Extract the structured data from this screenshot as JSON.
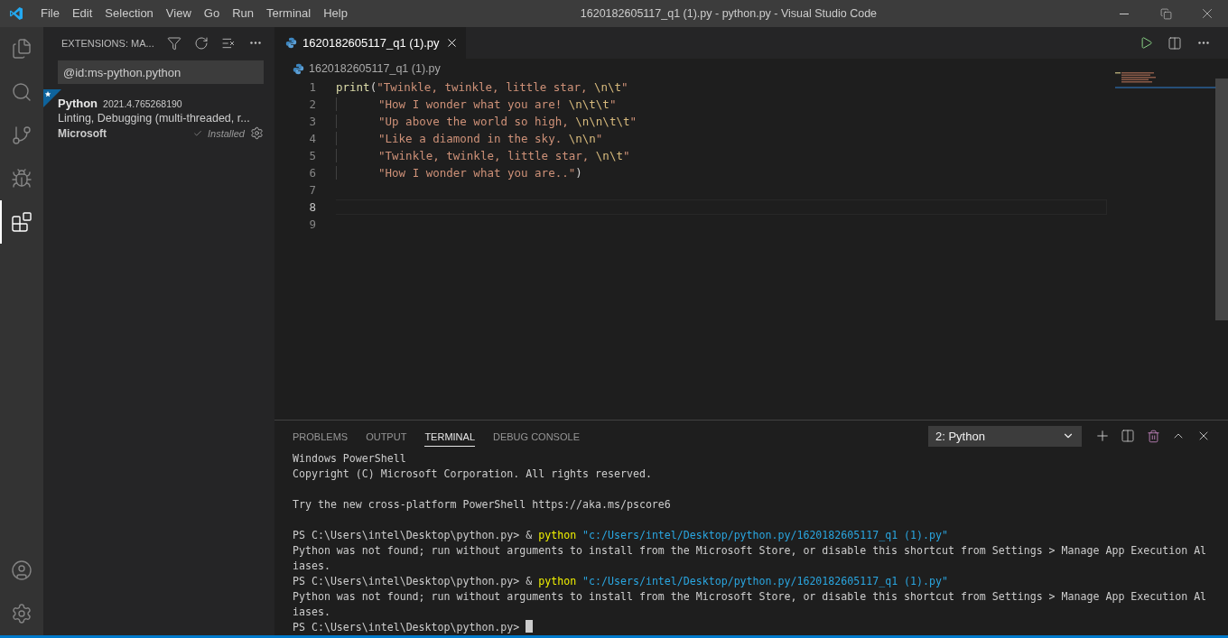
{
  "window": {
    "title": "1620182605117_q1 (1).py - python.py - Visual Studio Code"
  },
  "menu": [
    "File",
    "Edit",
    "Selection",
    "View",
    "Go",
    "Run",
    "Terminal",
    "Help"
  ],
  "activity_bar": [
    {
      "kind": "explorer",
      "selected": false
    },
    {
      "kind": "search",
      "selected": false
    },
    {
      "kind": "source-control",
      "selected": false
    },
    {
      "kind": "run",
      "selected": false
    },
    {
      "kind": "extensions",
      "selected": true
    }
  ],
  "activity_bar_bottom": [
    {
      "kind": "account"
    },
    {
      "kind": "settings"
    }
  ],
  "sidebar": {
    "title": "EXTENSIONS: MA...",
    "search": {
      "value": "@id:ms-python.python"
    },
    "extensions": [
      {
        "name": "Python",
        "version": "2021.4.765268190",
        "description": "Linting, Debugging (multi-threaded, r...",
        "publisher": "Microsoft",
        "status": "Installed",
        "recommended": true
      }
    ]
  },
  "editor": {
    "tabs": [
      {
        "label": "1620182605117_q1 (1).py",
        "selected": true
      }
    ],
    "breadcrumb": "1620182605117_q1 (1).py",
    "lines": [
      {
        "number": "1",
        "indented": false,
        "current": false,
        "tokens": [
          {
            "kind": "func",
            "text": "print"
          },
          {
            "kind": "punct",
            "text": "("
          },
          {
            "kind": "string",
            "text": "\"Twinkle, twinkle, little star, "
          },
          {
            "kind": "escape",
            "text": "\\n\\t"
          },
          {
            "kind": "string",
            "text": "\""
          }
        ]
      },
      {
        "number": "2",
        "indented": true,
        "current": false,
        "tokens": [
          {
            "kind": "string",
            "text": "\"How I wonder what you are! "
          },
          {
            "kind": "escape",
            "text": "\\n\\t\\t"
          },
          {
            "kind": "string",
            "text": "\""
          }
        ]
      },
      {
        "number": "3",
        "indented": true,
        "current": false,
        "tokens": [
          {
            "kind": "string",
            "text": "\"Up above the world so high, "
          },
          {
            "kind": "escape",
            "text": "\\n\\n\\t\\t"
          },
          {
            "kind": "string",
            "text": "\""
          }
        ]
      },
      {
        "number": "4",
        "indented": true,
        "current": false,
        "tokens": [
          {
            "kind": "string",
            "text": "\"Like a diamond in the sky. "
          },
          {
            "kind": "escape",
            "text": "\\n\\n"
          },
          {
            "kind": "string",
            "text": "\""
          }
        ]
      },
      {
        "number": "5",
        "indented": true,
        "current": false,
        "tokens": [
          {
            "kind": "string",
            "text": "\"Twinkle, twinkle, little star, "
          },
          {
            "kind": "escape",
            "text": "\\n\\t"
          },
          {
            "kind": "string",
            "text": "\""
          }
        ]
      },
      {
        "number": "6",
        "indented": true,
        "current": false,
        "tokens": [
          {
            "kind": "string",
            "text": "\"How I wonder what you are..\""
          },
          {
            "kind": "punct",
            "text": ")"
          }
        ]
      },
      {
        "number": "7",
        "current": false
      },
      {
        "number": "8",
        "current": true
      },
      {
        "number": "9",
        "current": false
      }
    ]
  },
  "panel": {
    "tabs": [
      {
        "label": "PROBLEMS",
        "selected": false
      },
      {
        "label": "OUTPUT",
        "selected": false
      },
      {
        "label": "TERMINAL",
        "selected": true
      },
      {
        "label": "DEBUG CONSOLE",
        "selected": false
      }
    ],
    "terminal_select": "2: Python",
    "terminal": [
      {
        "kind": "text",
        "segments": [
          {
            "kind": "plain",
            "text": "Windows PowerShell"
          }
        ]
      },
      {
        "kind": "text",
        "segments": [
          {
            "kind": "plain",
            "text": "Copyright (C) Microsoft Corporation. All rights reserved."
          }
        ]
      },
      {
        "kind": "blank"
      },
      {
        "kind": "text",
        "segments": [
          {
            "kind": "plain",
            "text": "Try the new cross-platform PowerShell https://aka.ms/pscore6"
          }
        ]
      },
      {
        "kind": "blank"
      },
      {
        "kind": "text",
        "segments": [
          {
            "kind": "plain",
            "text": "PS C:\\Users\\intel\\Desktop\\python.py> & "
          },
          {
            "kind": "command",
            "text": "python"
          },
          {
            "kind": "string",
            "text": " \"c:/Users/intel/Desktop/python.py/1620182605117_q1 (1).py\""
          }
        ]
      },
      {
        "kind": "text",
        "segments": [
          {
            "kind": "plain",
            "text": "Python was not found; run without arguments to install from the Microsoft Store, or disable this shortcut from Settings > Manage App Execution Al"
          }
        ]
      },
      {
        "kind": "text",
        "segments": [
          {
            "kind": "plain",
            "text": "iases."
          }
        ]
      },
      {
        "kind": "text",
        "segments": [
          {
            "kind": "plain",
            "text": "PS C:\\Users\\intel\\Desktop\\python.py> & "
          },
          {
            "kind": "command",
            "text": "python"
          },
          {
            "kind": "string",
            "text": " \"c:/Users/intel/Desktop/python.py/1620182605117_q1 (1).py\""
          }
        ]
      },
      {
        "kind": "text",
        "segments": [
          {
            "kind": "plain",
            "text": "Python was not found; run without arguments to install from the Microsoft Store, or disable this shortcut from Settings > Manage App Execution Al"
          }
        ]
      },
      {
        "kind": "text",
        "segments": [
          {
            "kind": "plain",
            "text": "iases."
          }
        ]
      },
      {
        "kind": "prompt",
        "segments": [
          {
            "kind": "plain",
            "text": "PS C:\\Users\\intel\\Desktop\\python.py> "
          }
        ]
      }
    ]
  }
}
